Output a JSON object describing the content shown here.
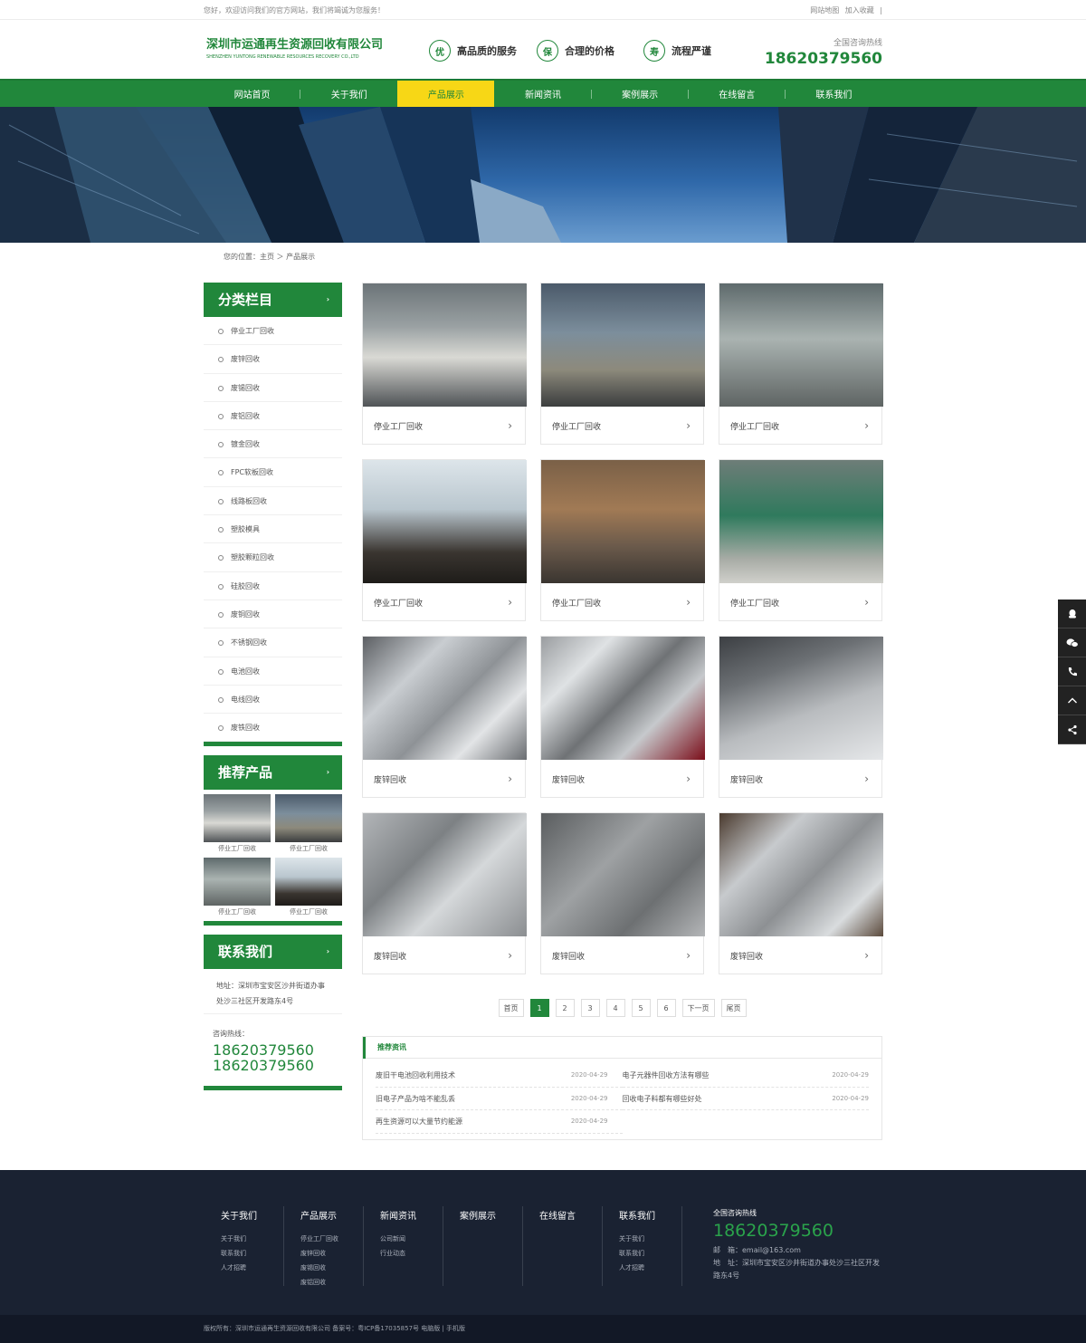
{
  "topbar": {
    "welcome": "您好，欢迎访问我们的官方网站，我们将竭诚为您服务！",
    "sitemap": "网站地图",
    "favorite": "加入收藏",
    "divider": "|"
  },
  "header": {
    "company_cn": "深圳市运通再生资源回收有限公司",
    "company_en": "SHENZHEN YUNTONG RENEWABLE RESOURCES RECOVERY CO.,LTD",
    "features": [
      {
        "badge": "优",
        "text": "高品质的服务"
      },
      {
        "badge": "保",
        "text": "合理的价格"
      },
      {
        "badge": "寿",
        "text": "流程严谨"
      }
    ],
    "hotline_label": "全国咨询热线",
    "hotline": "18620379560"
  },
  "nav": {
    "items": [
      "网站首页",
      "关于我们",
      "产品展示",
      "新闻资讯",
      "案例展示",
      "在线留言",
      "联系我们"
    ],
    "active": "产品展示"
  },
  "breadcrumb": "您的位置：主页 ＞ 产品展示",
  "sidebar": {
    "category_title": "分类栏目",
    "categories": [
      "停业工厂回收",
      "废锌回收",
      "废锡回收",
      "废铝回收",
      "镀金回收",
      "FPC软板回收",
      "线路板回收",
      "塑胶模具",
      "塑胶颗粒回收",
      "硅胶回收",
      "废铜回收",
      "不锈钢回收",
      "电池回收",
      "电线回收",
      "废铁回收"
    ],
    "recommend_title": "推荐产品",
    "recommend": [
      "停业工厂回收",
      "停业工厂回收",
      "停业工厂回收",
      "停业工厂回收"
    ],
    "contact_title": "联系我们",
    "address": "地址：深圳市宝安区沙井街道办事处沙三社区开发路东4号",
    "hotline_label": "咨询热线：",
    "phones": [
      "18620379560",
      "18620379560"
    ],
    "arrow": "›"
  },
  "products": [
    {
      "label": "停业工厂回收",
      "img": "ph-factory"
    },
    {
      "label": "停业工厂回收",
      "img": "ph-hall"
    },
    {
      "label": "停业工厂回收",
      "img": "ph-corridor"
    },
    {
      "label": "停业工厂回收",
      "img": "ph-tower"
    },
    {
      "label": "停业工厂回收",
      "img": "ph-coil"
    },
    {
      "label": "停业工厂回收",
      "img": "ph-press"
    },
    {
      "label": "废锌回收",
      "img": "ph-metal"
    },
    {
      "label": "废锌回收",
      "img": "ph-metal2"
    },
    {
      "label": "废锌回收",
      "img": "ph-metal3"
    },
    {
      "label": "废锌回收",
      "img": "ph-metal4"
    },
    {
      "label": "废锌回收",
      "img": "ph-metal5"
    },
    {
      "label": "废锌回收",
      "img": "ph-metal6"
    }
  ],
  "pager": [
    "首页",
    "1",
    "2",
    "3",
    "4",
    "5",
    "6",
    "下一页",
    "尾页"
  ],
  "pager_active": "1",
  "news": {
    "title": "推荐资讯",
    "items": [
      {
        "title": "废旧干电池回收利用技术",
        "date": "2020-04-29"
      },
      {
        "title": "电子元器件回收方法有哪些",
        "date": "2020-04-29"
      },
      {
        "title": "旧电子产品为啥不能乱丢",
        "date": "2020-04-29"
      },
      {
        "title": "回收电子料都有哪些好处",
        "date": "2020-04-29"
      },
      {
        "title": "再生资源可以大量节约能源",
        "date": "2020-04-29"
      }
    ]
  },
  "footer": {
    "columns": [
      {
        "title": "关于我们",
        "links": [
          "关于我们",
          "联系我们",
          "人才招聘"
        ]
      },
      {
        "title": "产品展示",
        "links": [
          "停业工厂回收",
          "废锌回收",
          "废锡回收",
          "废铝回收"
        ]
      },
      {
        "title": "新闻资讯",
        "links": [
          "公司新闻",
          "行业动态"
        ]
      },
      {
        "title": "案例展示",
        "links": []
      },
      {
        "title": "在线留言",
        "links": []
      },
      {
        "title": "联系我们",
        "links": [
          "关于我们",
          "联系我们",
          "人才招聘"
        ]
      }
    ],
    "hotline_label": "全国咨询热线",
    "hotline": "18620379560",
    "email": "邮　箱：email@163.com",
    "address": "地　址：深圳市宝安区沙井街道办事处沙三社区开发路东4号",
    "copyright": "版权所有：深圳市运通再生资源回收有限公司  备案号：粤ICP备17035857号  电脑版 | 手机版"
  },
  "float_icons": [
    "qq-icon",
    "wechat-icon",
    "phone-icon",
    "back-to-top-icon",
    "share-icon"
  ],
  "colors": {
    "brand": "#21873b",
    "nav_active": "#f7d716",
    "footer": "#1a2232"
  }
}
